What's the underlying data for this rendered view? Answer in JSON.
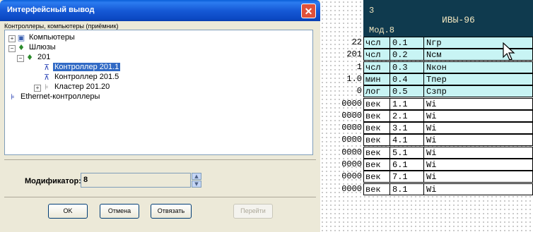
{
  "dialog": {
    "title": "Интерфейсный вывод",
    "close_glyph": "✕",
    "group_caption": "Контроллеры, компьютеры (приёмник)",
    "tree": [
      {
        "label": "Компьютеры",
        "icon": "computer-icon",
        "glyph": "▣",
        "expander": "+"
      },
      {
        "label": "Шлюзы",
        "icon": "gateway-icon",
        "glyph": "♦",
        "expander": "−"
      },
      {
        "label": "201",
        "icon": "gateway-icon",
        "glyph": "♦",
        "expander": "−"
      },
      {
        "label": "Контроллер 201.1",
        "icon": "controller-icon",
        "glyph": "⊼",
        "selected": true
      },
      {
        "label": "Контроллер 201.5",
        "icon": "controller-icon",
        "glyph": "⊼"
      },
      {
        "label": "Кластер 201.20",
        "icon": "cluster-icon",
        "glyph": "⊧",
        "expander": "+"
      },
      {
        "label": "Ethernet-контроллеры",
        "icon": "ethernet-controller-icon",
        "glyph": "⊧"
      }
    ],
    "modifier_label": "Модификатор:",
    "modifier_value": "8",
    "spin_up": "▲",
    "spin_down": "▼",
    "buttons": {
      "ok": "OK",
      "cancel": "Отмена",
      "unbind": "Отвязать",
      "go": "Перейти"
    }
  },
  "table": {
    "header": {
      "number": "3",
      "module": "Мод.8",
      "title": "ИВЫ-96"
    },
    "colors": {
      "header_bg": "#0f3a4e",
      "header_text": "#f2e6bf",
      "highlight_bg": "#c8f4f4",
      "value_bg": "#ffffff"
    },
    "rows": [
      {
        "value": "22",
        "type": "чсл",
        "addr": "0.1",
        "name": "Nгр",
        "highlight": true
      },
      {
        "value": "201",
        "type": "чсл",
        "addr": "0.2",
        "name": "Nсм",
        "highlight": true
      },
      {
        "value": "1",
        "type": "чсл",
        "addr": "0.3",
        "name": "Nкон",
        "highlight": true
      },
      {
        "value": "1.0",
        "type": "мин",
        "addr": "0.4",
        "name": "Tпер",
        "highlight": true
      },
      {
        "value": "0",
        "type": "лог",
        "addr": "0.5",
        "name": "Сзпр",
        "highlight": true
      },
      {
        "value": "0000",
        "type": "век",
        "addr": "1.1",
        "name": "Wi"
      },
      {
        "value": "0000",
        "type": "век",
        "addr": "2.1",
        "name": "Wi"
      },
      {
        "value": "0000",
        "type": "век",
        "addr": "3.1",
        "name": "Wi"
      },
      {
        "value": "0000",
        "type": "век",
        "addr": "4.1",
        "name": "Wi"
      },
      {
        "value": "0000",
        "type": "век",
        "addr": "5.1",
        "name": "Wi"
      },
      {
        "value": "0000",
        "type": "век",
        "addr": "6.1",
        "name": "Wi"
      },
      {
        "value": "0000",
        "type": "век",
        "addr": "7.1",
        "name": "Wi"
      },
      {
        "value": "0000",
        "type": "век",
        "addr": "8.1",
        "name": "Wi"
      }
    ]
  }
}
